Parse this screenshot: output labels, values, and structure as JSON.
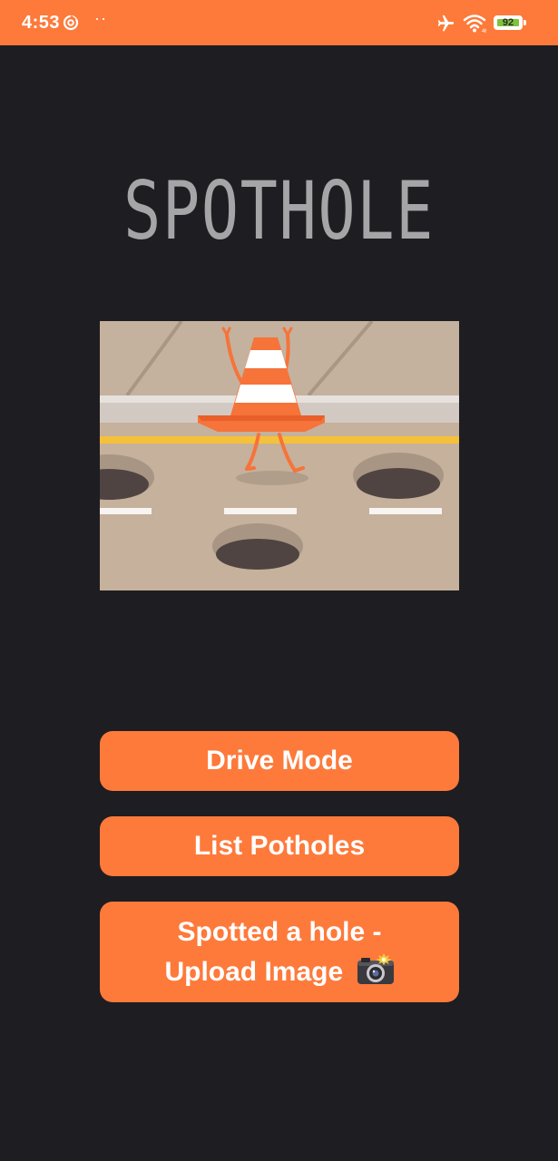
{
  "status_bar": {
    "time": "4:53",
    "dots": "··",
    "battery_level": "92",
    "icons": [
      "sync-icon",
      "airplane-icon",
      "wifi-icon",
      "battery-icon"
    ],
    "background": "#fd7a3b"
  },
  "app": {
    "title": "SPOTHOLE",
    "title_color": "#a5a5a7",
    "background": "#1e1d21"
  },
  "illustration": {
    "subject": "traffic-cone-and-potholes-illustration"
  },
  "buttons": {
    "drive_mode": "Drive Mode",
    "list_potholes": "List Potholes",
    "upload_line1": "Spotted a hole -",
    "upload_line2": "Upload Image",
    "upload_icon": "camera-icon",
    "color": "#fd7a3b"
  }
}
